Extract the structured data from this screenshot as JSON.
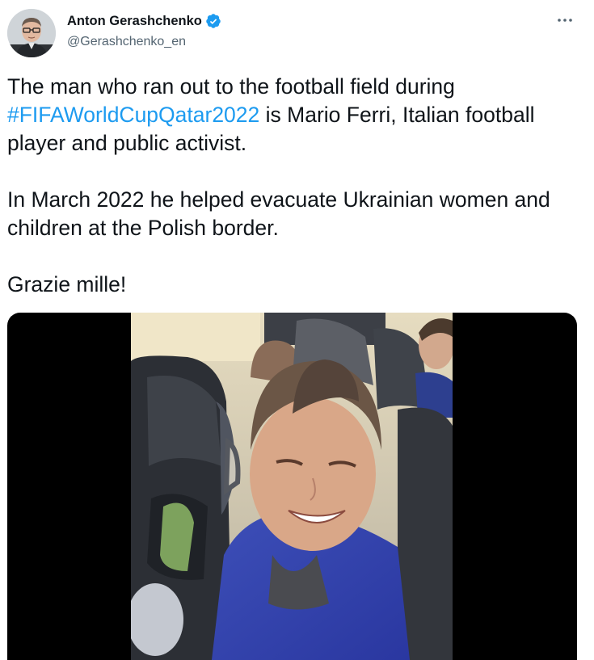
{
  "author": {
    "display_name": "Anton Gerashchenko",
    "handle": "@Gerashchenko_en",
    "verified": true,
    "avatar_icon": "person-avatar"
  },
  "menu": {
    "more_icon": "ellipsis-icon"
  },
  "tweet": {
    "line1_before": "The man who ran out to the football field during",
    "hashtag": "#FIFAWorldCupQatar2022",
    "line1_after": " is Mario Ferri, Italian football player and public activist.",
    "para2": "In March 2022 he helped evacuate Ukrainian women and children at the Polish border.",
    "para3": "Grazie mille!"
  },
  "media": {
    "type": "video",
    "content": "video-frame"
  },
  "colors": {
    "link": "#1d9bf0",
    "text": "#0f1419",
    "secondary": "#536471",
    "verified": "#1d9bf0"
  }
}
